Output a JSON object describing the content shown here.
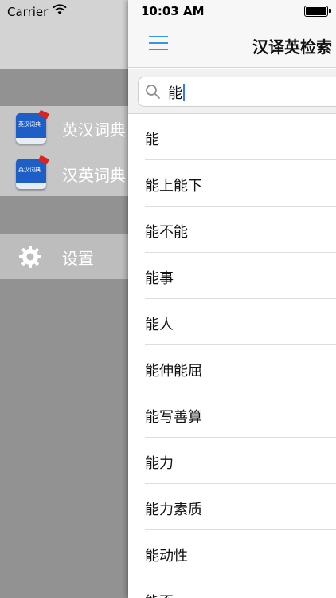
{
  "status": {
    "carrier": "Carrier",
    "time": "10:03 AM"
  },
  "drawer": {
    "items": [
      {
        "label": "英汉词典",
        "icon": "book-icon",
        "badge": "英汉词典"
      },
      {
        "label": "汉英词典",
        "icon": "book-icon",
        "badge": "英汉词典"
      },
      {
        "label": "设置",
        "icon": "gear-icon"
      }
    ]
  },
  "navbar": {
    "title": "汉译英检索",
    "menu_icon": "hamburger-icon"
  },
  "search": {
    "value": "能",
    "icon": "search-icon"
  },
  "results": [
    "能",
    "能上能下",
    "能不能",
    "能事",
    "能人",
    "能伸能屈",
    "能写善算",
    "能力",
    "能力素质",
    "能动性",
    "能否"
  ],
  "colors": {
    "accent": "#3b95d8",
    "drawer_bg": "#929292",
    "selected_row": "#c6c6c6"
  }
}
